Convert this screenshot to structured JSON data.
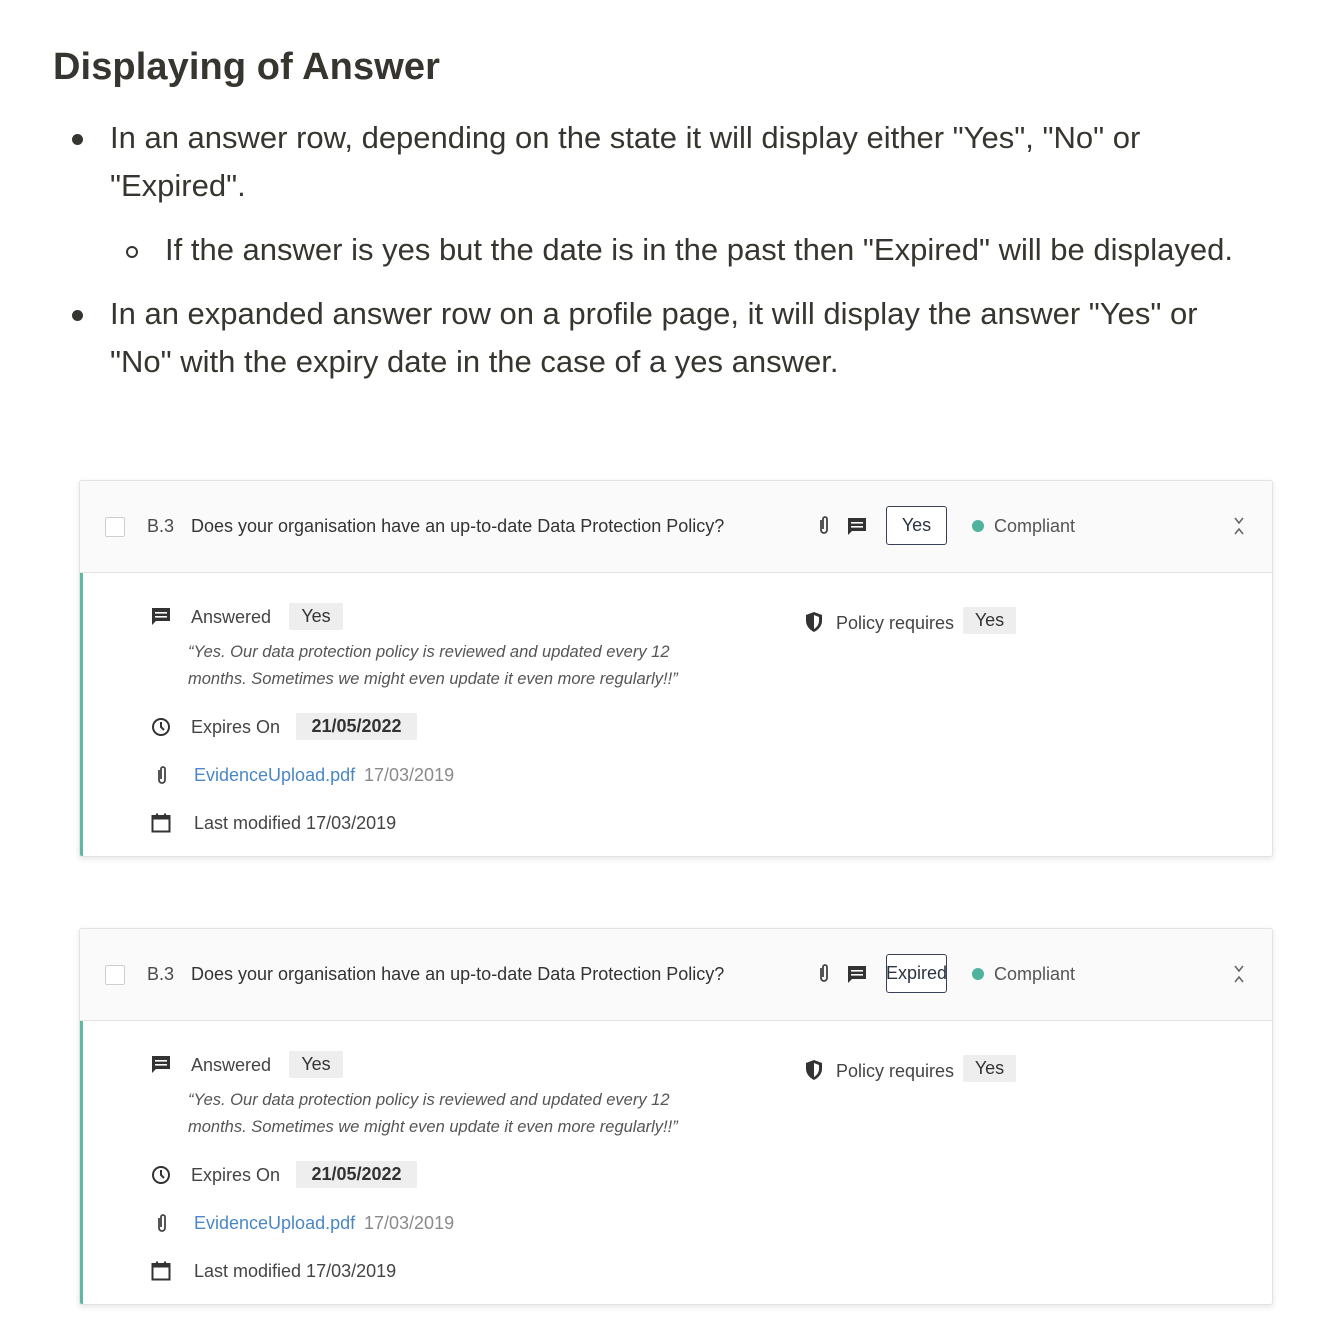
{
  "doc": {
    "heading": "Displaying of Answer",
    "bullets": [
      {
        "lines": [
          "In an answer row, depending on the state it will display either \"Yes\", \"No\" or",
          "\"Expired\"."
        ],
        "sub": [
          "If the answer is yes but the date is in the past then \"Expired\" will be displayed."
        ]
      },
      {
        "lines": [
          "In an expanded answer row on a profile page, it will display the answer \"Yes\" or",
          "\"No\" with the expiry date in the case of a yes answer."
        ]
      }
    ]
  },
  "cards": [
    {
      "question_number": "B.3",
      "question_text": "Does your organisation have an up-to-date Data Protection Policy?",
      "answer_badge": "Yes",
      "status": "Compliant",
      "status_color": "#4db39c",
      "answered_label": "Answered",
      "answered_value": "Yes",
      "quote_line1": "“Yes. Our data protection policy is reviewed and updated every 12",
      "quote_line2": "months. Sometimes we might even update it even more regularly!!”",
      "expires_label": "Expires On",
      "expires_date": "21/05/2022",
      "file_name": "EvidenceUpload.pdf",
      "file_date": "17/03/2019",
      "last_modified": "Last modified 17/03/2019",
      "policy_label": "Policy requires",
      "policy_value": "Yes"
    },
    {
      "question_number": "B.3",
      "question_text": "Does your organisation have an up-to-date Data Protection Policy?",
      "answer_badge": "Expired",
      "status": "Compliant",
      "status_color": "#4db39c",
      "answered_label": "Answered",
      "answered_value": "Yes",
      "quote_line1": "“Yes. Our data protection policy is reviewed and updated every 12",
      "quote_line2": "months. Sometimes we might even update it even more regularly!!”",
      "expires_label": "Expires On",
      "expires_date": "21/05/2022",
      "file_name": "EvidenceUpload.pdf",
      "file_date": "17/03/2019",
      "last_modified": "Last modified 17/03/2019",
      "policy_label": "Policy requires",
      "policy_value": "Yes"
    }
  ],
  "icons": {
    "attachment": "paperclip-icon",
    "comment": "comment-icon",
    "collapse": "collapse-icon",
    "clock": "clock-icon",
    "shield": "shield-icon",
    "calendar": "calendar-icon"
  },
  "colors": {
    "accent_border": "#5fb8a3",
    "link": "#4a87c4",
    "text": "#37352f"
  }
}
